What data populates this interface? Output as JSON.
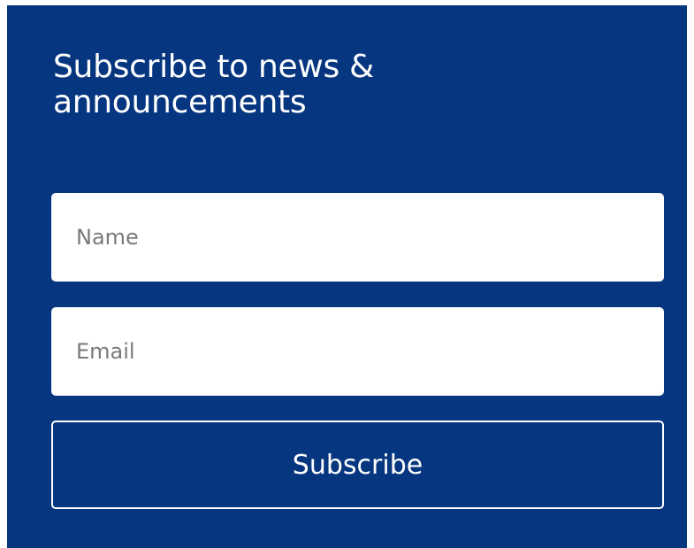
{
  "colors": {
    "panel_background": "#063680",
    "text_on_panel": "#ffffff",
    "field_background": "#ffffff",
    "placeholder_text": "#7a7a7a"
  },
  "subscribe_form": {
    "heading": "Subscribe to news & announcements",
    "name_field": {
      "placeholder": "Name",
      "value": ""
    },
    "email_field": {
      "placeholder": "Email",
      "value": ""
    },
    "submit_label": "Subscribe"
  }
}
